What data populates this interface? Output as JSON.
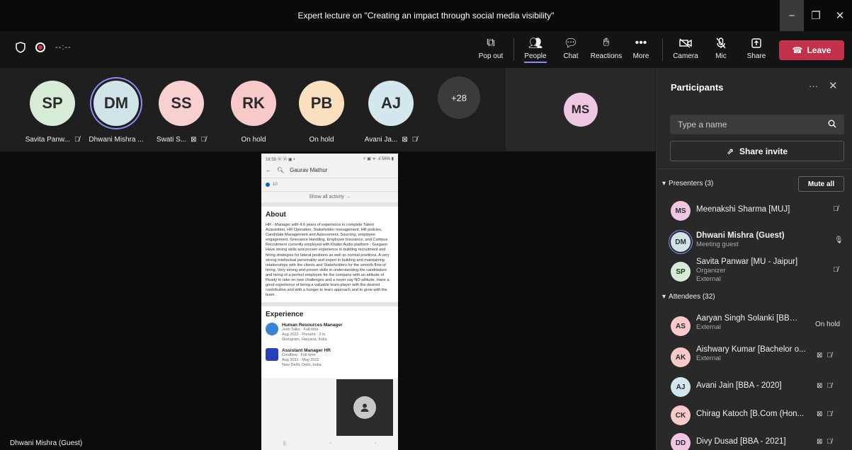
{
  "window": {
    "title": "Expert lecture on \"Creating an impact through social media visibility\""
  },
  "toolbar": {
    "timer": "--:--",
    "buttons": {
      "popout": "Pop out",
      "people": "People",
      "chat": "Chat",
      "reactions": "Reactions",
      "more": "More",
      "camera": "Camera",
      "mic": "Mic",
      "share": "Share"
    },
    "leave_label": "Leave",
    "leave_color": "#c4314b"
  },
  "strip": {
    "tiles": [
      {
        "initials": "SP",
        "name": "Savita Panw...",
        "color": "#d7ecd7"
      },
      {
        "initials": "DM",
        "name": "Dhwani Mishra ...",
        "color": "#cfe3e8"
      },
      {
        "initials": "SS",
        "name": "Swati S...",
        "color": "#f8d0d0"
      },
      {
        "initials": "RK",
        "name": "On hold",
        "color": "#f7c9c9"
      },
      {
        "initials": "PB",
        "name": "On hold",
        "color": "#fbe0bf"
      },
      {
        "initials": "AJ",
        "name": "Avani Ja...",
        "color": "#d3e7ef"
      }
    ],
    "overflow": "+28",
    "side_tile": {
      "initials": "MS",
      "color": "#f0c7e3"
    }
  },
  "stage": {
    "phone": {
      "status_left": "16:59 ⓦ ⓦ ▣ •",
      "status_right": "⚡ ▣ ᯤ .ıl 56% ▮",
      "search": "Gaurav Mathur",
      "count": "10",
      "show_all": "Show all activity →",
      "about_heading": "About",
      "about_text": "HR - Manager with 4.6 years of experience in complete Talent Acquisition, HR Operation, Stakeholder management, HR policies, Candidate Management and Assessment, Sourcing, employee engagement, Grievance Handling, Employee Insurance, and Campus Recruitment currently employed with Khabri Audio platform - Gurgaon Have strong skills and proven experience in building recruitment and hiring strategies for lateral positions as well as normal positions. A very strong intellectual personality and expert in building and maintaining relationships with the clients and Stakeholders for the smooth flow of hiring. Very strong and proven skills in understanding the candidature and hiring of a perfect employee for the company with an attitude of Ready to take on new challenges and a never say NO attitude. Have a good experience of being a valuable team player with the desired contribution and with a hunger to learn approach and to grow with the team.",
      "experience_heading": "Experience",
      "jobs": [
        {
          "title": "Human Resources Manager",
          "company": "Josh Talks · Full-time",
          "dates": "Aug 2022 - Present · 2 m",
          "place": "Gurugram, Haryana, India"
        },
        {
          "title": "Assistant Manager HR",
          "company": "Credflow · Full-time",
          "dates": "Aug 2021 - May 2022",
          "place": "New Delhi, Delhi, India"
        }
      ]
    },
    "speaker_name": "Dhwani Mishra (Guest)"
  },
  "panel": {
    "title": "Participants",
    "search_placeholder": "Type a name",
    "share_invite": "Share invite",
    "presenters_label": "Presenters (3)",
    "mute_all": "Mute all",
    "presenters": [
      {
        "initials": "MS",
        "name": "Meenakshi Sharma [MUJ]",
        "sub1": "",
        "sub2": "",
        "color": "#f0c7e3"
      },
      {
        "initials": "DM",
        "name": "Dhwani Mishra (Guest)",
        "sub1": "Meeting guest",
        "sub2": "",
        "color": "#cfe3e8"
      },
      {
        "initials": "SP",
        "name": "Savita Panwar [MU - Jaipur]",
        "sub1": "Organizer",
        "sub2": "External",
        "color": "#d7ecd7"
      }
    ],
    "attendees_label": "Attendees (32)",
    "attendees": [
      {
        "initials": "AS",
        "name": "Aaryan Singh Solanki [BBA - 2...",
        "sub1": "External",
        "status": "On hold",
        "color": "#f7c9c9"
      },
      {
        "initials": "AK",
        "name": "Aishwary Kumar [Bachelor o...",
        "sub1": "External",
        "status": "",
        "color": "#f7c9c9"
      },
      {
        "initials": "AJ",
        "name": "Avani Jain [BBA - 2020]",
        "sub1": "",
        "status": "",
        "color": "#d3e7ef"
      },
      {
        "initials": "CK",
        "name": "Chirag Katoch [B.Com (Hon...",
        "sub1": "",
        "status": "",
        "color": "#f7c9c9"
      },
      {
        "initials": "DD",
        "name": "Divy Dusad [BBA - 2021]",
        "sub1": "",
        "status": "",
        "color": "#f0c7e3"
      }
    ]
  }
}
